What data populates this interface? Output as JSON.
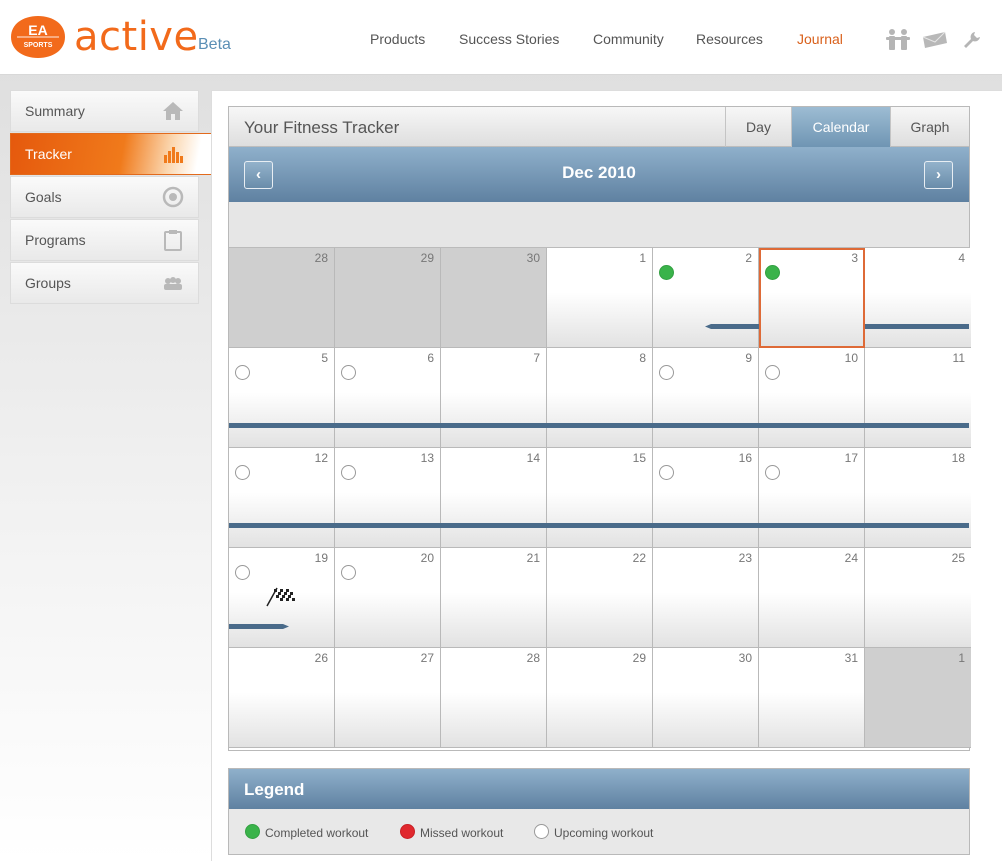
{
  "brand": {
    "badge_line1": "EA",
    "badge_line2": "SPORTS",
    "wordmark": "active",
    "tag": "Beta"
  },
  "nav": [
    {
      "label": "Products"
    },
    {
      "label": "Success Stories"
    },
    {
      "label": "Community"
    },
    {
      "label": "Resources"
    },
    {
      "label": "Journal",
      "active": true
    }
  ],
  "header_icons": [
    "people-icon",
    "mail-icon",
    "wrench-icon"
  ],
  "sidebar": {
    "items": [
      {
        "label": "Summary",
        "icon": "home-icon"
      },
      {
        "label": "Tracker",
        "icon": "bar-chart-icon",
        "active": true
      },
      {
        "label": "Goals",
        "icon": "target-icon"
      },
      {
        "label": "Programs",
        "icon": "clipboard-icon"
      },
      {
        "label": "Groups",
        "icon": "group-icon"
      }
    ]
  },
  "tracker": {
    "title": "Your Fitness Tracker",
    "tabs": [
      {
        "label": "Day"
      },
      {
        "label": "Calendar",
        "active": true
      },
      {
        "label": "Graph"
      }
    ],
    "month": "Dec 2010",
    "prev": "‹",
    "next": "›"
  },
  "calendar": {
    "weeks": [
      [
        {
          "d": "28",
          "other": true
        },
        {
          "d": "29",
          "other": true
        },
        {
          "d": "30",
          "other": true
        },
        {
          "d": "1"
        },
        {
          "d": "2",
          "status": "completed"
        },
        {
          "d": "3",
          "status": "completed",
          "today": true
        },
        {
          "d": "4"
        }
      ],
      [
        {
          "d": "5",
          "status": "upcoming"
        },
        {
          "d": "6",
          "status": "upcoming"
        },
        {
          "d": "7"
        },
        {
          "d": "8"
        },
        {
          "d": "9",
          "status": "upcoming"
        },
        {
          "d": "10",
          "status": "upcoming"
        },
        {
          "d": "11"
        }
      ],
      [
        {
          "d": "12",
          "status": "upcoming"
        },
        {
          "d": "13",
          "status": "upcoming"
        },
        {
          "d": "14"
        },
        {
          "d": "15"
        },
        {
          "d": "16",
          "status": "upcoming"
        },
        {
          "d": "17",
          "status": "upcoming"
        },
        {
          "d": "18"
        }
      ],
      [
        {
          "d": "19",
          "status": "upcoming",
          "flag": true
        },
        {
          "d": "20",
          "status": "upcoming"
        },
        {
          "d": "21"
        },
        {
          "d": "22"
        },
        {
          "d": "23"
        },
        {
          "d": "24"
        },
        {
          "d": "25"
        }
      ],
      [
        {
          "d": "26"
        },
        {
          "d": "27"
        },
        {
          "d": "28"
        },
        {
          "d": "29"
        },
        {
          "d": "30"
        },
        {
          "d": "31"
        },
        {
          "d": "1",
          "other": true
        }
      ]
    ]
  },
  "legend": {
    "title": "Legend",
    "items": [
      {
        "label": "Completed workout",
        "color": "#3ab34a"
      },
      {
        "label": "Missed workout",
        "color": "#e0282e"
      },
      {
        "label": "Upcoming workout",
        "color": "#ffffff"
      }
    ]
  }
}
